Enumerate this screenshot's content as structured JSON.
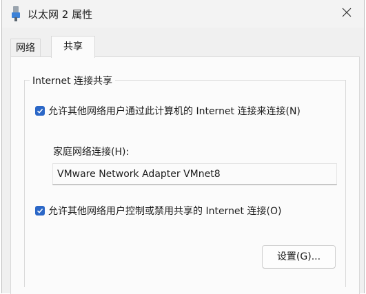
{
  "window": {
    "title": "以太网 2 属性",
    "title_icon": "network-adapter-icon",
    "close_icon": "close-icon"
  },
  "tabs": [
    {
      "label": "网络",
      "selected": false
    },
    {
      "label": "共享",
      "selected": true
    }
  ],
  "sharing": {
    "group_label": "Internet 连接共享",
    "allow_connect": {
      "label": "允许其他网络用户通过此计算机的 Internet 连接来连接(N)",
      "checked": true
    },
    "home_network_label": "家庭网络连接(H):",
    "home_network_value": "VMware Network Adapter VMnet8",
    "allow_control": {
      "label": "允许其他网络用户控制或禁用共享的 Internet 连接(O)",
      "checked": true
    },
    "settings_button": "设置(G)..."
  },
  "colors": {
    "accent": "#2b67c7",
    "window_bg": "#f0f0f0",
    "panel_bg": "#fbfbfb"
  }
}
